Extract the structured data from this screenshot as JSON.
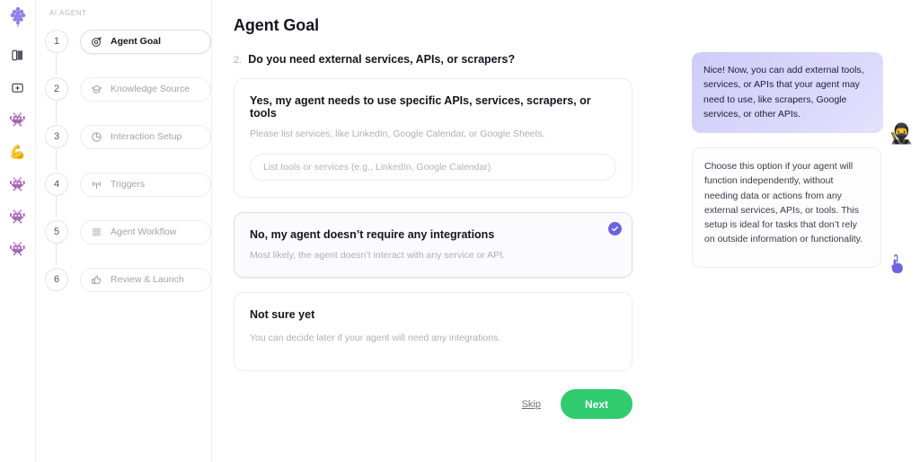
{
  "rail": {
    "logo_icon": "grape-logo-icon",
    "items": [
      {
        "icon": "book-open-icon",
        "glyph": "❑"
      },
      {
        "icon": "folder-add-icon",
        "glyph": "⧉"
      },
      {
        "icon": "robot-face-icon",
        "glyph": "👾"
      },
      {
        "icon": "muscle-arm-icon",
        "glyph": "💪"
      },
      {
        "icon": "robot-face-icon",
        "glyph": "👾"
      },
      {
        "icon": "robot-face-icon",
        "glyph": "👾"
      },
      {
        "icon": "robot-face-icon",
        "glyph": "👾"
      }
    ]
  },
  "stepper": {
    "section_label": "AI AGENT",
    "steps": [
      {
        "number": "1",
        "label": "Agent Goal",
        "icon": "target-icon",
        "active": true
      },
      {
        "number": "2",
        "label": "Knowledge Source",
        "icon": "graduation-cap-icon",
        "active": false
      },
      {
        "number": "3",
        "label": "Interaction Setup",
        "icon": "clock-pie-icon",
        "active": false
      },
      {
        "number": "4",
        "label": "Triggers",
        "icon": "signal-antenna-icon",
        "active": false
      },
      {
        "number": "5",
        "label": "Agent Workflow",
        "icon": "list-lines-icon",
        "active": false
      },
      {
        "number": "6",
        "label": "Review & Launch",
        "icon": "thumbs-up-icon",
        "active": false
      }
    ]
  },
  "main": {
    "page_title": "Agent Goal",
    "question_number": "2.",
    "question_text": "Do you need external services, APIs, or scrapers?",
    "options": [
      {
        "title": "Yes, my agent needs to use specific APIs, services, scrapers, or tools",
        "subtitle": "Please list services, like LinkedIn, Google Calendar, or Google Sheets.",
        "input_placeholder": "List tools or services (e.g., LinkedIn, Google Calendar)",
        "input_value": "",
        "selected": false
      },
      {
        "title": "No, my agent doesn’t require any integrations",
        "subtitle": "Most likely, the agent doesn’t interact with any service or API.",
        "selected": true
      },
      {
        "title": "Not sure yet",
        "subtitle": "You can decide later if your agent will need any integrations.",
        "selected": false
      }
    ],
    "skip_label": "Skip",
    "next_label": "Next"
  },
  "assistant": {
    "bubbles": [
      {
        "text": "Nice! Now, you can add external tools, services, or APIs that your agent may need to use, like scrapers, Google services, or other APIs.",
        "avatar_icon": "ninja-avatar-icon",
        "avatar_glyph": "🥷"
      },
      {
        "text": "Choose this option if your agent will function independently, without needing data or actions from any external services, APIs, or tools. This setup is ideal for tasks that don’t rely on outside information or functionality.",
        "cursor_icon": "pointing-hand-cursor-icon"
      }
    ]
  },
  "colors": {
    "accent_purple": "#6C63E0",
    "next_green": "#2FCB6E",
    "bubble_lavender": "#D6D3F9",
    "text_dark": "#15151F",
    "text_muted": "#AEAEBA"
  }
}
